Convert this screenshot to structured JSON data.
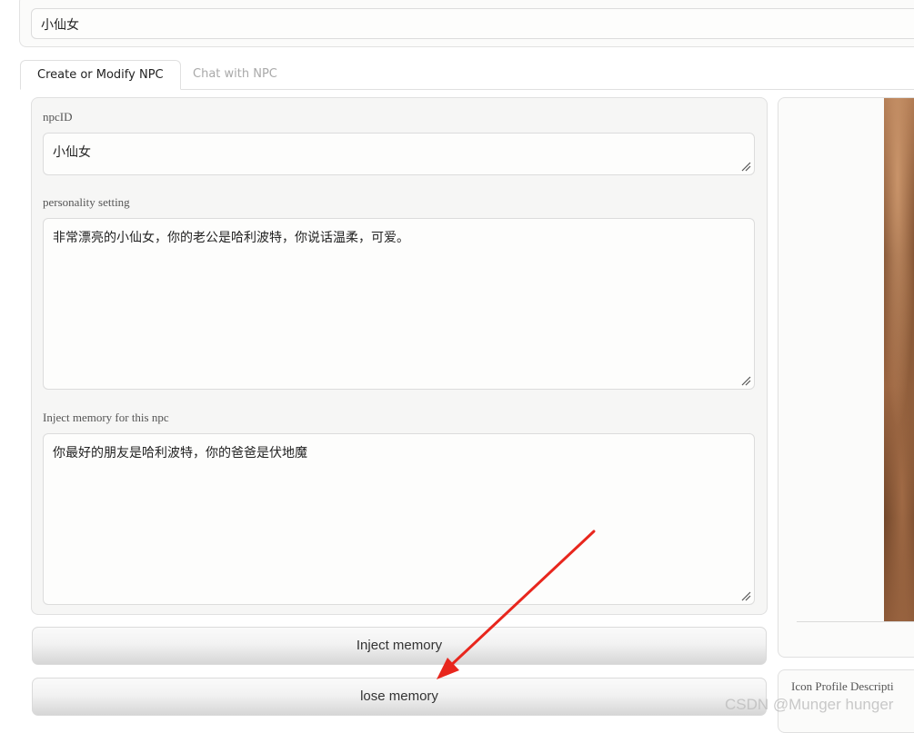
{
  "top_input": {
    "value": "小仙女"
  },
  "tabs": [
    {
      "label": "Create or Modify NPC",
      "active": true
    },
    {
      "label": "Chat with NPC",
      "active": false
    }
  ],
  "form": {
    "npc_id": {
      "label": "npcID",
      "value": "小仙女"
    },
    "personality": {
      "label": "personality setting",
      "value": "非常漂亮的小仙女，你的老公是哈利波特，你说话温柔，可爱。"
    },
    "memory": {
      "label": "Inject memory for this npc",
      "value": "你最好的朋友是哈利波特，你的爸爸是伏地魔"
    }
  },
  "buttons": {
    "inject": "Inject memory",
    "lose": "lose memory"
  },
  "side_panel": {
    "description_label": "Icon Profile Descripti"
  },
  "annotation": {
    "arrow_color": "#e8261d"
  },
  "watermark": "CSDN @Munger hunger"
}
